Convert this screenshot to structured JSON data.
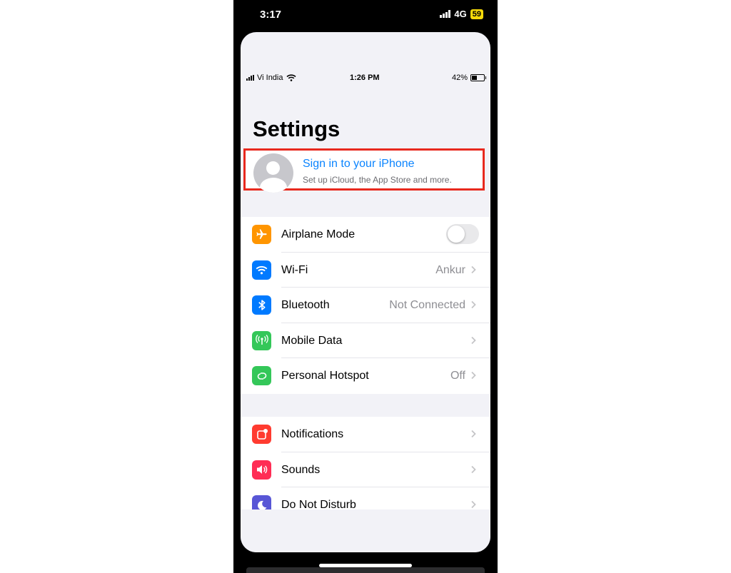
{
  "outer_status": {
    "time": "3:17",
    "network": "4G",
    "battery": "59"
  },
  "inner_status": {
    "carrier": "Vi India",
    "time": "1:26 PM",
    "battery": "42%"
  },
  "page": {
    "title": "Settings"
  },
  "signin": {
    "title": "Sign in to your iPhone",
    "subtitle": "Set up iCloud, the App Store and more."
  },
  "group1": [
    {
      "label": "Airplane Mode",
      "icon": "airplane-icon",
      "color": "#ff9500",
      "toggle": false
    },
    {
      "label": "Wi-Fi",
      "value": "Ankur",
      "icon": "wifi-icon",
      "color": "#007aff"
    },
    {
      "label": "Bluetooth",
      "value": "Not Connected",
      "icon": "bluetooth-icon",
      "color": "#007aff"
    },
    {
      "label": "Mobile Data",
      "value": "",
      "icon": "antenna-icon",
      "color": "#34c759"
    },
    {
      "label": "Personal Hotspot",
      "value": "Off",
      "icon": "hotspot-icon",
      "color": "#34c759"
    }
  ],
  "group2": [
    {
      "label": "Notifications",
      "icon": "notifications-icon",
      "color": "#ff3b30"
    },
    {
      "label": "Sounds",
      "icon": "speaker-icon",
      "color": "#ff2d55"
    },
    {
      "label": "Do Not Disturb",
      "icon": "moon-icon",
      "color": "#5856d6"
    }
  ]
}
